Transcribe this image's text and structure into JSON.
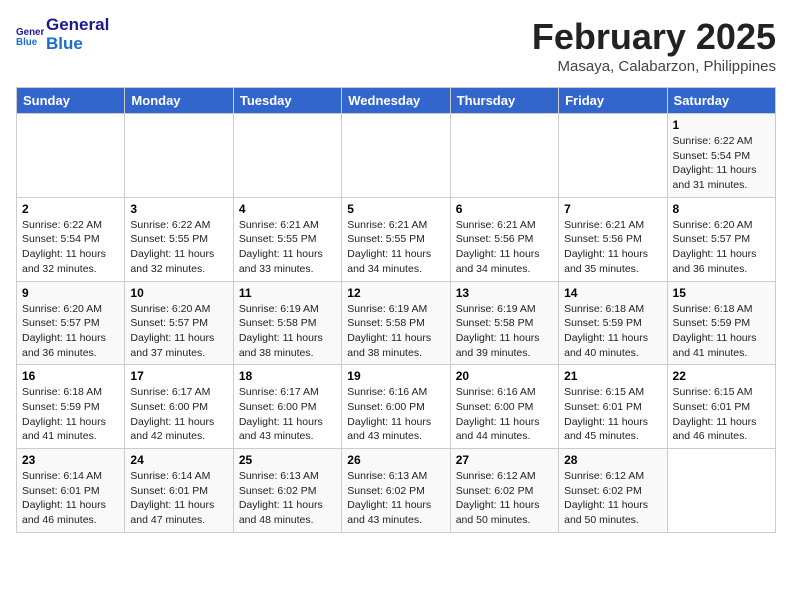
{
  "logo": {
    "general": "General",
    "blue": "Blue"
  },
  "header": {
    "title": "February 2025",
    "subtitle": "Masaya, Calabarzon, Philippines"
  },
  "weekdays": [
    "Sunday",
    "Monday",
    "Tuesday",
    "Wednesday",
    "Thursday",
    "Friday",
    "Saturday"
  ],
  "weeks": [
    [
      {
        "day": "",
        "info": ""
      },
      {
        "day": "",
        "info": ""
      },
      {
        "day": "",
        "info": ""
      },
      {
        "day": "",
        "info": ""
      },
      {
        "day": "",
        "info": ""
      },
      {
        "day": "",
        "info": ""
      },
      {
        "day": "1",
        "info": "Sunrise: 6:22 AM\nSunset: 5:54 PM\nDaylight: 11 hours\nand 31 minutes."
      }
    ],
    [
      {
        "day": "2",
        "info": "Sunrise: 6:22 AM\nSunset: 5:54 PM\nDaylight: 11 hours\nand 32 minutes."
      },
      {
        "day": "3",
        "info": "Sunrise: 6:22 AM\nSunset: 5:55 PM\nDaylight: 11 hours\nand 32 minutes."
      },
      {
        "day": "4",
        "info": "Sunrise: 6:21 AM\nSunset: 5:55 PM\nDaylight: 11 hours\nand 33 minutes."
      },
      {
        "day": "5",
        "info": "Sunrise: 6:21 AM\nSunset: 5:55 PM\nDaylight: 11 hours\nand 34 minutes."
      },
      {
        "day": "6",
        "info": "Sunrise: 6:21 AM\nSunset: 5:56 PM\nDaylight: 11 hours\nand 34 minutes."
      },
      {
        "day": "7",
        "info": "Sunrise: 6:21 AM\nSunset: 5:56 PM\nDaylight: 11 hours\nand 35 minutes."
      },
      {
        "day": "8",
        "info": "Sunrise: 6:20 AM\nSunset: 5:57 PM\nDaylight: 11 hours\nand 36 minutes."
      }
    ],
    [
      {
        "day": "9",
        "info": "Sunrise: 6:20 AM\nSunset: 5:57 PM\nDaylight: 11 hours\nand 36 minutes."
      },
      {
        "day": "10",
        "info": "Sunrise: 6:20 AM\nSunset: 5:57 PM\nDaylight: 11 hours\nand 37 minutes."
      },
      {
        "day": "11",
        "info": "Sunrise: 6:19 AM\nSunset: 5:58 PM\nDaylight: 11 hours\nand 38 minutes."
      },
      {
        "day": "12",
        "info": "Sunrise: 6:19 AM\nSunset: 5:58 PM\nDaylight: 11 hours\nand 38 minutes."
      },
      {
        "day": "13",
        "info": "Sunrise: 6:19 AM\nSunset: 5:58 PM\nDaylight: 11 hours\nand 39 minutes."
      },
      {
        "day": "14",
        "info": "Sunrise: 6:18 AM\nSunset: 5:59 PM\nDaylight: 11 hours\nand 40 minutes."
      },
      {
        "day": "15",
        "info": "Sunrise: 6:18 AM\nSunset: 5:59 PM\nDaylight: 11 hours\nand 41 minutes."
      }
    ],
    [
      {
        "day": "16",
        "info": "Sunrise: 6:18 AM\nSunset: 5:59 PM\nDaylight: 11 hours\nand 41 minutes."
      },
      {
        "day": "17",
        "info": "Sunrise: 6:17 AM\nSunset: 6:00 PM\nDaylight: 11 hours\nand 42 minutes."
      },
      {
        "day": "18",
        "info": "Sunrise: 6:17 AM\nSunset: 6:00 PM\nDaylight: 11 hours\nand 43 minutes."
      },
      {
        "day": "19",
        "info": "Sunrise: 6:16 AM\nSunset: 6:00 PM\nDaylight: 11 hours\nand 43 minutes."
      },
      {
        "day": "20",
        "info": "Sunrise: 6:16 AM\nSunset: 6:00 PM\nDaylight: 11 hours\nand 44 minutes."
      },
      {
        "day": "21",
        "info": "Sunrise: 6:15 AM\nSunset: 6:01 PM\nDaylight: 11 hours\nand 45 minutes."
      },
      {
        "day": "22",
        "info": "Sunrise: 6:15 AM\nSunset: 6:01 PM\nDaylight: 11 hours\nand 46 minutes."
      }
    ],
    [
      {
        "day": "23",
        "info": "Sunrise: 6:14 AM\nSunset: 6:01 PM\nDaylight: 11 hours\nand 46 minutes."
      },
      {
        "day": "24",
        "info": "Sunrise: 6:14 AM\nSunset: 6:01 PM\nDaylight: 11 hours\nand 47 minutes."
      },
      {
        "day": "25",
        "info": "Sunrise: 6:13 AM\nSunset: 6:02 PM\nDaylight: 11 hours\nand 48 minutes."
      },
      {
        "day": "26",
        "info": "Sunrise: 6:13 AM\nSunset: 6:02 PM\nDaylight: 11 hours\nand 43 minutes."
      },
      {
        "day": "27",
        "info": "Sunrise: 6:12 AM\nSunset: 6:02 PM\nDaylight: 11 hours\nand 50 minutes."
      },
      {
        "day": "28",
        "info": "Sunrise: 6:12 AM\nSunset: 6:02 PM\nDaylight: 11 hours\nand 50 minutes."
      },
      {
        "day": "",
        "info": ""
      }
    ]
  ]
}
